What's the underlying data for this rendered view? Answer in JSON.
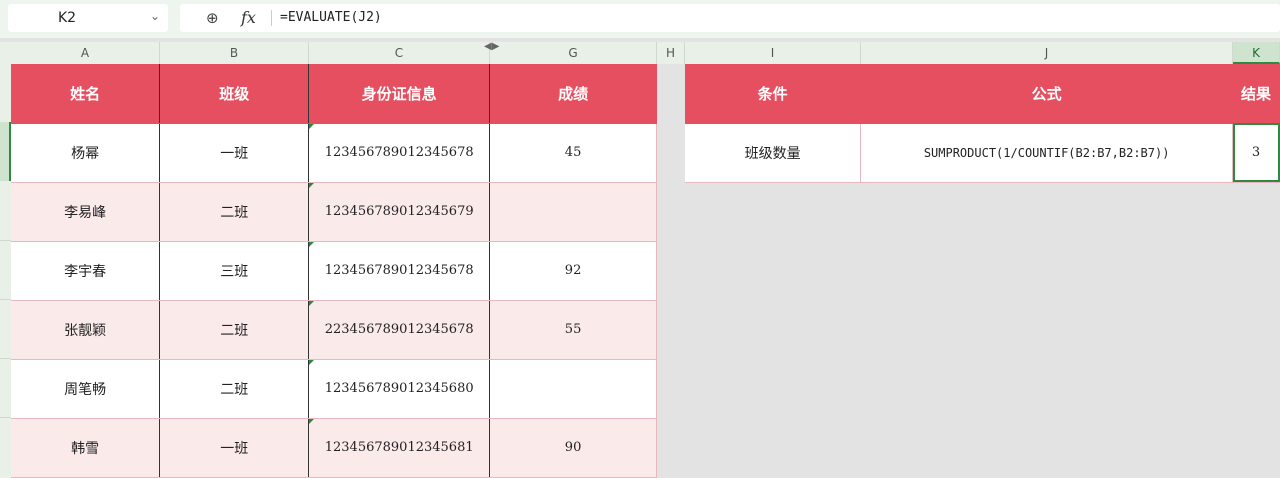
{
  "formula_bar": {
    "name_box": "K2",
    "formula": "=EVALUATE(J2)"
  },
  "columns": [
    "A",
    "B",
    "C",
    "G",
    "H",
    "I",
    "J",
    "K"
  ],
  "left_table": {
    "headers": [
      "姓名",
      "班级",
      "身份证信息",
      "成绩"
    ],
    "rows": [
      {
        "name": "杨幂",
        "class": "一班",
        "id": "123456789012345678",
        "score": "45"
      },
      {
        "name": "李易峰",
        "class": "二班",
        "id": "123456789012345679",
        "score": ""
      },
      {
        "name": "李宇春",
        "class": "三班",
        "id": "123456789012345678",
        "score": "92"
      },
      {
        "name": "张靓颖",
        "class": "二班",
        "id": "223456789012345678",
        "score": "55"
      },
      {
        "name": "周笔畅",
        "class": "二班",
        "id": "123456789012345680",
        "score": ""
      },
      {
        "name": "韩雪",
        "class": "一班",
        "id": "123456789012345681",
        "score": "90"
      }
    ]
  },
  "right_table": {
    "headers": [
      "条件",
      "公式",
      "结果"
    ],
    "row": {
      "condition": "班级数量",
      "formula": "SUMPRODUCT(1/COUNTIF(B2:B7,B2:B7))",
      "result": "3"
    }
  },
  "colors": {
    "header_bg": "#e64f5f",
    "stripe": "#fbeaea",
    "selection": "#2f8a3f"
  },
  "icons": {
    "zoom": "zoom-icon",
    "fx": "fx-icon",
    "dropdown": "chevron-down-icon"
  }
}
